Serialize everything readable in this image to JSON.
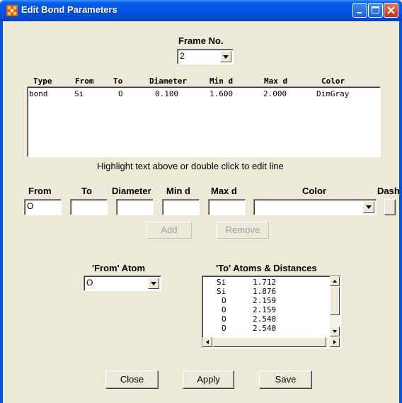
{
  "window": {
    "title": "Edit Bond Parameters"
  },
  "frame": {
    "label": "Frame No.",
    "value": "2"
  },
  "bond_table": {
    "headers": [
      "Type",
      "From",
      "To",
      "Diameter",
      "Min d",
      "Max d",
      "Color"
    ],
    "rows": [
      {
        "type": "bond",
        "from": "Si",
        "to": "O",
        "diameter": "0.100",
        "min_d": "1.600",
        "max_d": "2.000",
        "color": "DimGray"
      }
    ]
  },
  "hint": "Highlight text above or double click to edit line",
  "editor": {
    "labels": {
      "from": "From",
      "to": "To",
      "diameter": "Diameter",
      "min_d": "Min d",
      "max_d": "Max d",
      "color": "Color",
      "dash": "Dash"
    },
    "values": {
      "from": "O",
      "to": "",
      "diameter": "",
      "min_d": "",
      "max_d": "",
      "color": ""
    }
  },
  "actions": {
    "add": "Add",
    "remove": "Remove"
  },
  "from_atom": {
    "label": "'From' Atom",
    "value": "O"
  },
  "to_atoms": {
    "label": "'To' Atoms & Distances",
    "items": [
      {
        "atom": "Si",
        "distance": "1.712"
      },
      {
        "atom": "Si",
        "distance": "1.876"
      },
      {
        "atom": "O",
        "distance": "2.159"
      },
      {
        "atom": "O",
        "distance": "2.159"
      },
      {
        "atom": "O",
        "distance": "2.540"
      },
      {
        "atom": "O",
        "distance": "2.540"
      }
    ]
  },
  "footer": {
    "close": "Close",
    "apply": "Apply",
    "save": "Save"
  }
}
